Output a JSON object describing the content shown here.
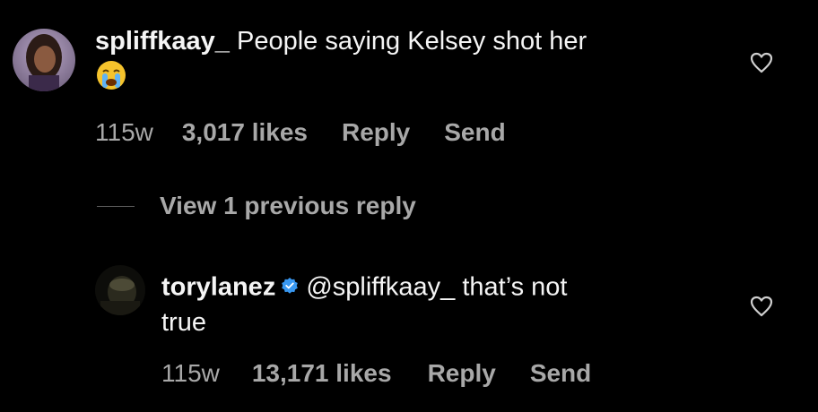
{
  "comments": [
    {
      "username": "spliffkaay_",
      "text": "People saying Kelsey shot her",
      "emoji": "😭",
      "age": "115w",
      "likes": "3,017 likes",
      "reply": "Reply",
      "send": "Send"
    },
    {
      "username": "torylanez",
      "mention": "@spliffkaay_",
      "text_line1": "that’s not",
      "text_line2": "true",
      "age": "115w",
      "likes": "13,171 likes",
      "reply": "Reply",
      "send": "Send"
    }
  ],
  "view_replies": {
    "label": "View 1 previous reply"
  },
  "icons": {
    "like": "heart-outline-icon",
    "verified": "verified-badge-icon"
  },
  "colors": {
    "background": "#000000",
    "text": "#f5f5f5",
    "secondary_text": "#a8a8a8",
    "verified": "#3897f0"
  }
}
